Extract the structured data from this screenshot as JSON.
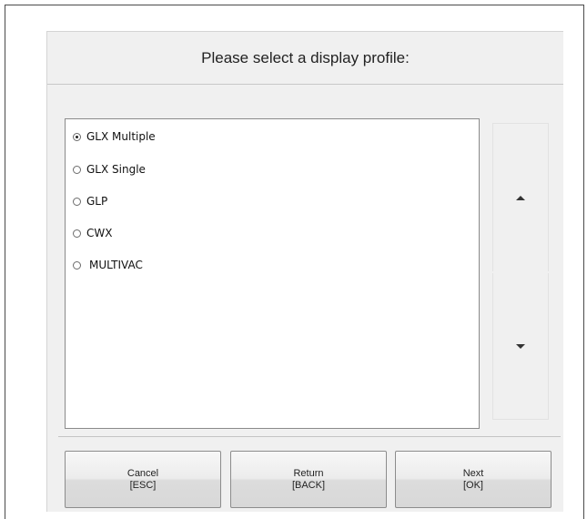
{
  "dialog": {
    "title": "Please select a display profile:"
  },
  "profiles": [
    {
      "label": "GLX Multiple",
      "selected": true
    },
    {
      "label": "GLX Single",
      "selected": false
    },
    {
      "label": "GLP",
      "selected": false
    },
    {
      "label": "CWX",
      "selected": false
    },
    {
      "label": "MULTIVAC",
      "selected": false
    }
  ],
  "scroll": {
    "up_icon": "triangle-up",
    "down_icon": "triangle-down"
  },
  "buttons": {
    "cancel": {
      "label": "Cancel",
      "key": "[ESC]"
    },
    "return": {
      "label": "Return",
      "key": "[BACK]"
    },
    "next": {
      "label": "Next",
      "key": "[OK]"
    }
  }
}
